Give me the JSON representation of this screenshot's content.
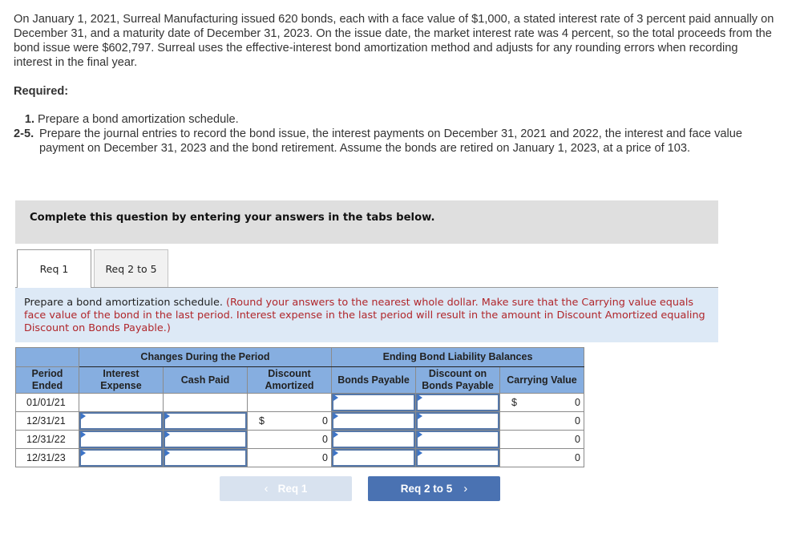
{
  "problem": {
    "text": "On January 1, 2021, Surreal Manufacturing issued 620 bonds, each with a face value of $1,000, a stated interest rate of 3 percent paid annually on December 31, and a maturity date of December 31, 2023. On the issue date, the market interest rate was 4 percent, so the total proceeds from the bond issue were $602,797. Surreal uses the effective-interest bond amortization method and adjusts for any rounding errors when recording interest in the final year."
  },
  "required": {
    "title": "Required:",
    "items": [
      {
        "num": "1.",
        "text": "Prepare a bond amortization schedule."
      },
      {
        "num": "2-5.",
        "text": "Prepare the journal entries to record the bond issue, the interest payments on December 31, 2021 and 2022, the interest and face value payment on December 31, 2023 and the bond retirement. Assume the bonds are retired on January 1, 2023, at a price of 103."
      }
    ]
  },
  "instruction_banner": "Complete this question by entering your answers in the tabs below.",
  "tabs": [
    {
      "label": "Req 1",
      "active": true
    },
    {
      "label": "Req 2 to 5",
      "active": false
    }
  ],
  "prompt": {
    "main": "Prepare a bond amortization schedule.",
    "hint": "(Round your answers to the nearest whole dollar. Make sure that the Carrying value equals face value of the bond in the last period. Interest expense in the last period will result in the amount in Discount Amortized equaling Discount on Bonds Payable.)"
  },
  "schedule": {
    "group_headers": {
      "changes": "Changes During the Period",
      "ending": "Ending Bond Liability Balances"
    },
    "columns": {
      "period": "Period Ended",
      "interest_expense": "Interest Expense",
      "cash_paid": "Cash Paid",
      "discount_amortized": "Discount Amortized",
      "bonds_payable": "Bonds Payable",
      "discount_on_bp": "Discount on Bonds Payable",
      "carrying_value": "Carrying Value"
    },
    "currency_symbol": "$",
    "rows": [
      {
        "period": "01/01/21",
        "interest_expense": "",
        "cash_paid": "",
        "discount_amortized": "",
        "bonds_payable": "",
        "discount_on_bp": "",
        "carrying_value": "0"
      },
      {
        "period": "12/31/21",
        "interest_expense": "",
        "cash_paid": "",
        "discount_amortized": "0",
        "bonds_payable": "",
        "discount_on_bp": "",
        "carrying_value": "0"
      },
      {
        "period": "12/31/22",
        "interest_expense": "",
        "cash_paid": "",
        "discount_amortized": "0",
        "bonds_payable": "",
        "discount_on_bp": "",
        "carrying_value": "0"
      },
      {
        "period": "12/31/23",
        "interest_expense": "",
        "cash_paid": "",
        "discount_amortized": "0",
        "bonds_payable": "",
        "discount_on_bp": "",
        "carrying_value": "0"
      }
    ]
  },
  "navigation": {
    "prev_label": "Req 1",
    "prev_icon": "chevron-left-icon",
    "next_label": "Req 2 to 5",
    "next_icon": "chevron-right-icon"
  }
}
